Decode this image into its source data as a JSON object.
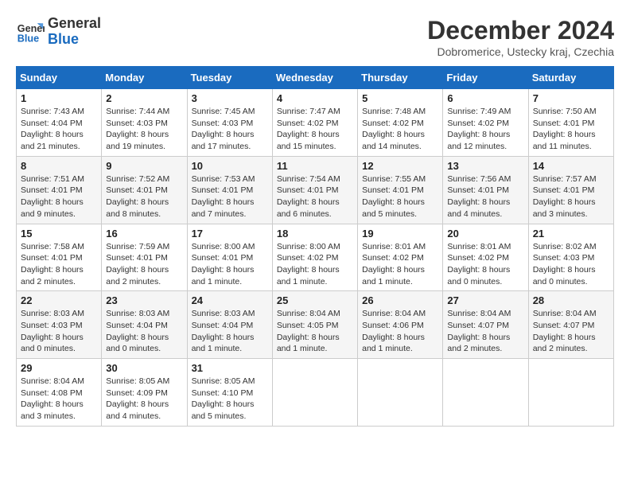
{
  "header": {
    "logo_line1": "General",
    "logo_line2": "Blue",
    "month": "December 2024",
    "location": "Dobromerice, Ustecky kraj, Czechia"
  },
  "weekdays": [
    "Sunday",
    "Monday",
    "Tuesday",
    "Wednesday",
    "Thursday",
    "Friday",
    "Saturday"
  ],
  "weeks": [
    [
      {
        "day": "1",
        "info": "Sunrise: 7:43 AM\nSunset: 4:04 PM\nDaylight: 8 hours\nand 21 minutes."
      },
      {
        "day": "2",
        "info": "Sunrise: 7:44 AM\nSunset: 4:03 PM\nDaylight: 8 hours\nand 19 minutes."
      },
      {
        "day": "3",
        "info": "Sunrise: 7:45 AM\nSunset: 4:03 PM\nDaylight: 8 hours\nand 17 minutes."
      },
      {
        "day": "4",
        "info": "Sunrise: 7:47 AM\nSunset: 4:02 PM\nDaylight: 8 hours\nand 15 minutes."
      },
      {
        "day": "5",
        "info": "Sunrise: 7:48 AM\nSunset: 4:02 PM\nDaylight: 8 hours\nand 14 minutes."
      },
      {
        "day": "6",
        "info": "Sunrise: 7:49 AM\nSunset: 4:02 PM\nDaylight: 8 hours\nand 12 minutes."
      },
      {
        "day": "7",
        "info": "Sunrise: 7:50 AM\nSunset: 4:01 PM\nDaylight: 8 hours\nand 11 minutes."
      }
    ],
    [
      {
        "day": "8",
        "info": "Sunrise: 7:51 AM\nSunset: 4:01 PM\nDaylight: 8 hours\nand 9 minutes."
      },
      {
        "day": "9",
        "info": "Sunrise: 7:52 AM\nSunset: 4:01 PM\nDaylight: 8 hours\nand 8 minutes."
      },
      {
        "day": "10",
        "info": "Sunrise: 7:53 AM\nSunset: 4:01 PM\nDaylight: 8 hours\nand 7 minutes."
      },
      {
        "day": "11",
        "info": "Sunrise: 7:54 AM\nSunset: 4:01 PM\nDaylight: 8 hours\nand 6 minutes."
      },
      {
        "day": "12",
        "info": "Sunrise: 7:55 AM\nSunset: 4:01 PM\nDaylight: 8 hours\nand 5 minutes."
      },
      {
        "day": "13",
        "info": "Sunrise: 7:56 AM\nSunset: 4:01 PM\nDaylight: 8 hours\nand 4 minutes."
      },
      {
        "day": "14",
        "info": "Sunrise: 7:57 AM\nSunset: 4:01 PM\nDaylight: 8 hours\nand 3 minutes."
      }
    ],
    [
      {
        "day": "15",
        "info": "Sunrise: 7:58 AM\nSunset: 4:01 PM\nDaylight: 8 hours\nand 2 minutes."
      },
      {
        "day": "16",
        "info": "Sunrise: 7:59 AM\nSunset: 4:01 PM\nDaylight: 8 hours\nand 2 minutes."
      },
      {
        "day": "17",
        "info": "Sunrise: 8:00 AM\nSunset: 4:01 PM\nDaylight: 8 hours\nand 1 minute."
      },
      {
        "day": "18",
        "info": "Sunrise: 8:00 AM\nSunset: 4:02 PM\nDaylight: 8 hours\nand 1 minute."
      },
      {
        "day": "19",
        "info": "Sunrise: 8:01 AM\nSunset: 4:02 PM\nDaylight: 8 hours\nand 1 minute."
      },
      {
        "day": "20",
        "info": "Sunrise: 8:01 AM\nSunset: 4:02 PM\nDaylight: 8 hours\nand 0 minutes."
      },
      {
        "day": "21",
        "info": "Sunrise: 8:02 AM\nSunset: 4:03 PM\nDaylight: 8 hours\nand 0 minutes."
      }
    ],
    [
      {
        "day": "22",
        "info": "Sunrise: 8:03 AM\nSunset: 4:03 PM\nDaylight: 8 hours\nand 0 minutes."
      },
      {
        "day": "23",
        "info": "Sunrise: 8:03 AM\nSunset: 4:04 PM\nDaylight: 8 hours\nand 0 minutes."
      },
      {
        "day": "24",
        "info": "Sunrise: 8:03 AM\nSunset: 4:04 PM\nDaylight: 8 hours\nand 1 minute."
      },
      {
        "day": "25",
        "info": "Sunrise: 8:04 AM\nSunset: 4:05 PM\nDaylight: 8 hours\nand 1 minute."
      },
      {
        "day": "26",
        "info": "Sunrise: 8:04 AM\nSunset: 4:06 PM\nDaylight: 8 hours\nand 1 minute."
      },
      {
        "day": "27",
        "info": "Sunrise: 8:04 AM\nSunset: 4:07 PM\nDaylight: 8 hours\nand 2 minutes."
      },
      {
        "day": "28",
        "info": "Sunrise: 8:04 AM\nSunset: 4:07 PM\nDaylight: 8 hours\nand 2 minutes."
      }
    ],
    [
      {
        "day": "29",
        "info": "Sunrise: 8:04 AM\nSunset: 4:08 PM\nDaylight: 8 hours\nand 3 minutes."
      },
      {
        "day": "30",
        "info": "Sunrise: 8:05 AM\nSunset: 4:09 PM\nDaylight: 8 hours\nand 4 minutes."
      },
      {
        "day": "31",
        "info": "Sunrise: 8:05 AM\nSunset: 4:10 PM\nDaylight: 8 hours\nand 5 minutes."
      },
      null,
      null,
      null,
      null
    ]
  ]
}
